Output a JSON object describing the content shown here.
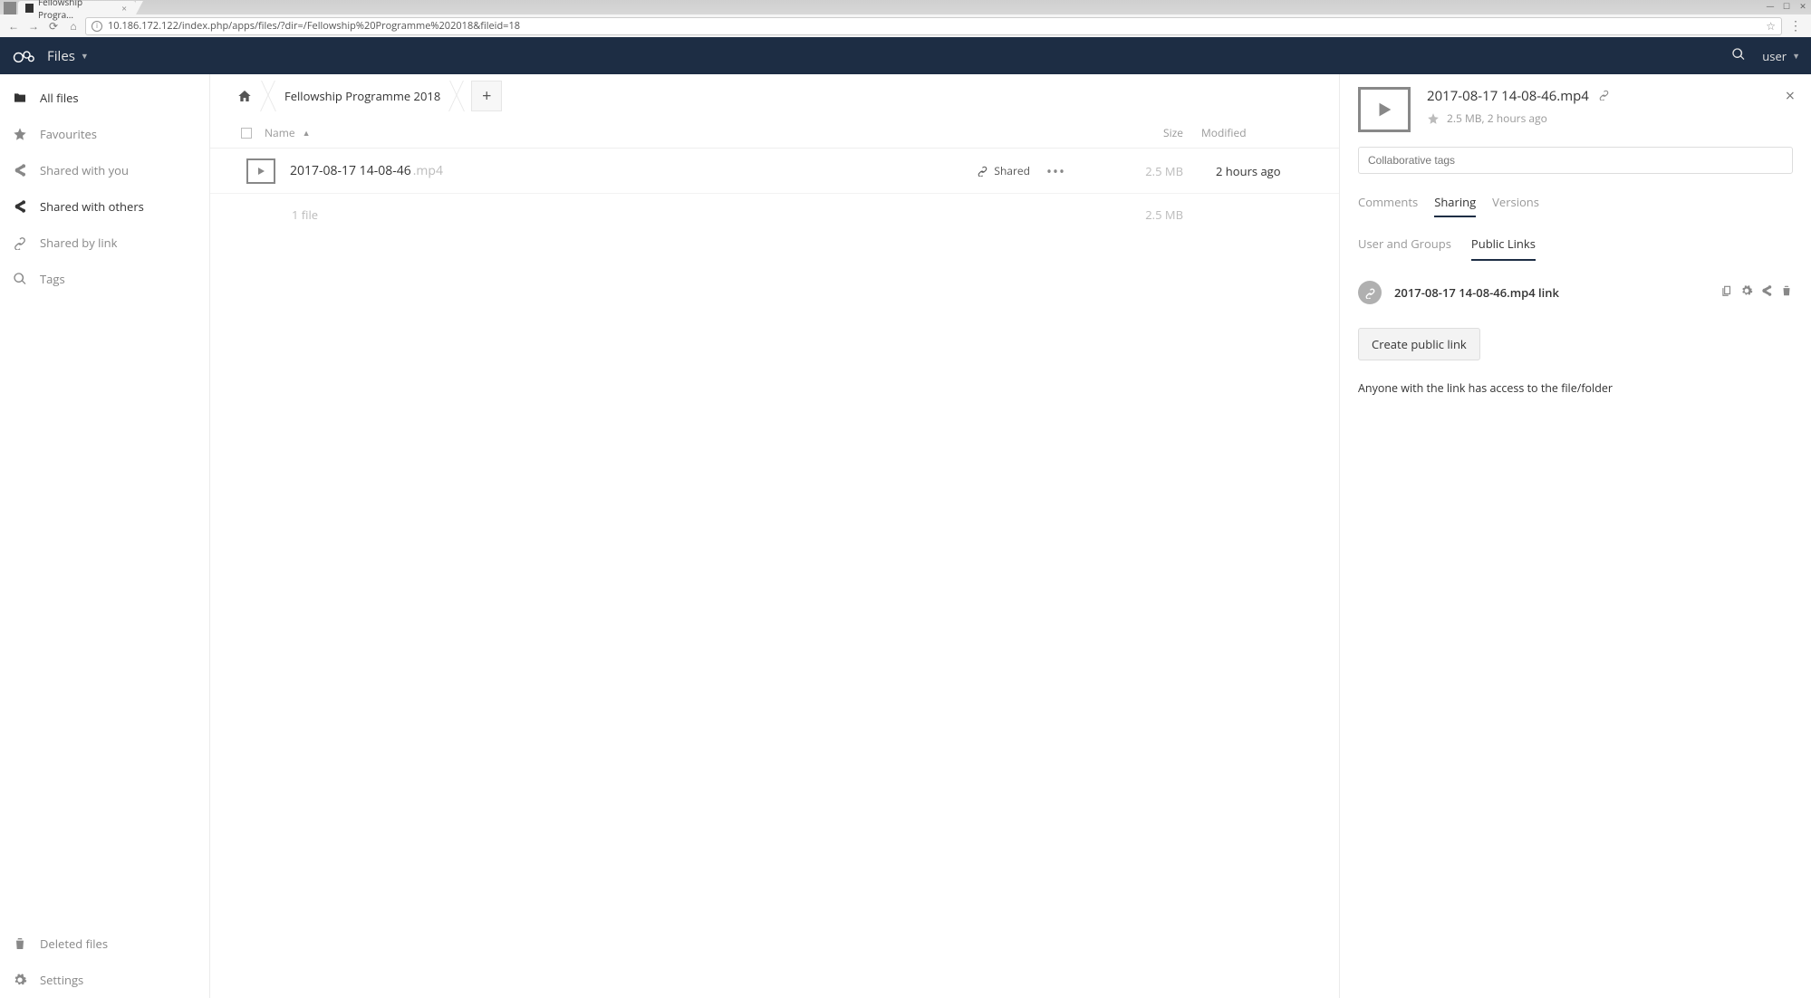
{
  "browser": {
    "tab_title": "Fellowship Progra...",
    "url": "10.186.172.122/index.php/apps/files/?dir=/Fellowship%20Programme%202018&fileid=18"
  },
  "header": {
    "app_name": "Files",
    "user": "user"
  },
  "sidebar": {
    "items": [
      {
        "label": "All files"
      },
      {
        "label": "Favourites"
      },
      {
        "label": "Shared with you"
      },
      {
        "label": "Shared with others"
      },
      {
        "label": "Shared by link"
      },
      {
        "label": "Tags"
      }
    ],
    "bottom": [
      {
        "label": "Deleted files"
      },
      {
        "label": "Settings"
      }
    ]
  },
  "breadcrumb": {
    "current": "Fellowship Programme 2018"
  },
  "columns": {
    "name": "Name",
    "size": "Size",
    "modified": "Modified"
  },
  "files": [
    {
      "name": "2017-08-17 14-08-46",
      "ext": ".mp4",
      "shared_label": "Shared",
      "size": "2.5 MB",
      "modified": "2 hours ago"
    }
  ],
  "summary": {
    "count": "1 file",
    "size": "2.5 MB"
  },
  "details": {
    "title": "2017-08-17 14-08-46.mp4",
    "subtitle": "2.5 MB, 2 hours ago",
    "tags_placeholder": "Collaborative tags",
    "tabs": {
      "comments": "Comments",
      "sharing": "Sharing",
      "versions": "Versions"
    },
    "subtabs": {
      "users": "User and Groups",
      "public": "Public Links"
    },
    "link_name": "2017-08-17 14-08-46.mp4 link",
    "create_label": "Create public link",
    "hint": "Anyone with the link has access to the file/folder"
  }
}
